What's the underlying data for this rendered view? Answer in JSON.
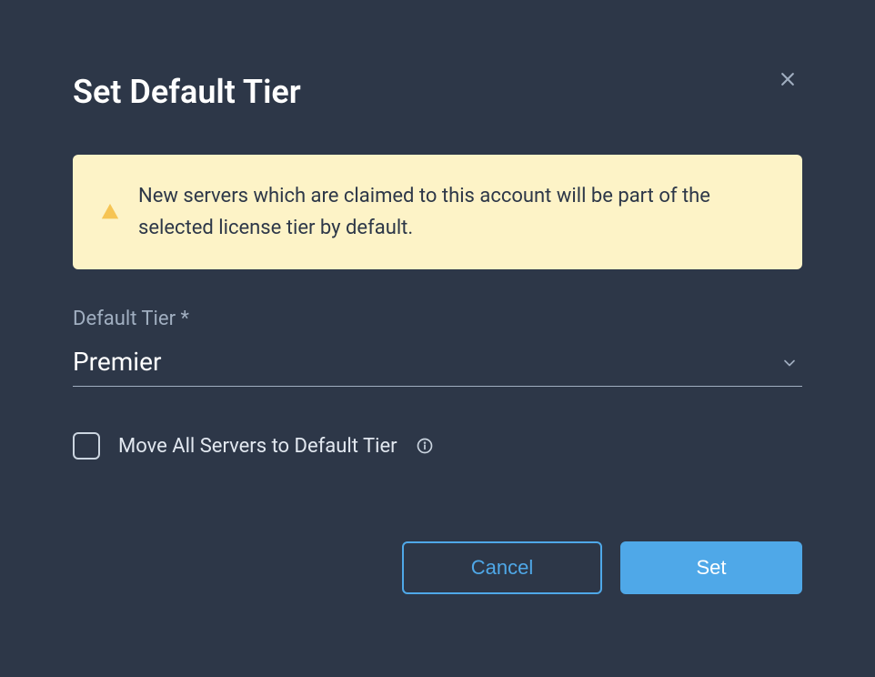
{
  "dialog": {
    "title": "Set Default Tier",
    "alert_message": "New servers which are claimed to this account will be part of the selected license tier by default.",
    "field_label": "Default Tier *",
    "selected_value": "Premier",
    "checkbox_label": "Move All Servers to Default Tier",
    "cancel_label": "Cancel",
    "set_label": "Set"
  }
}
